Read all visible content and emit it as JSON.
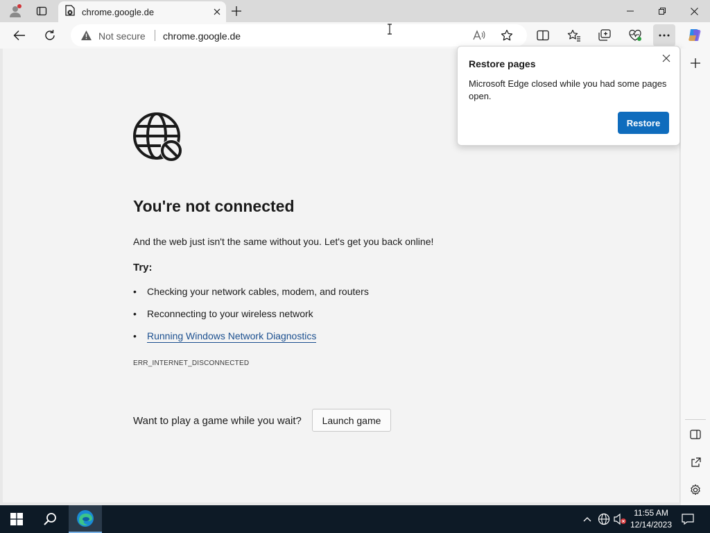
{
  "browser": {
    "tab": {
      "title": "chrome.google.de"
    },
    "address_bar": {
      "security_label": "Not secure",
      "url": "chrome.google.de"
    }
  },
  "error_page": {
    "headline": "You're not connected",
    "subtext": "And the web just isn't the same without you. Let's get you back online!",
    "try_label": "Try:",
    "suggestions": [
      {
        "text": "Checking your network cables, modem, and routers",
        "is_link": false
      },
      {
        "text": "Reconnecting to your wireless network",
        "is_link": false
      },
      {
        "text": "Running Windows Network Diagnostics",
        "is_link": true
      }
    ],
    "error_code": "ERR_INTERNET_DISCONNECTED",
    "game_prompt": "Want to play a game while you wait?",
    "game_button": "Launch game"
  },
  "popup": {
    "title": "Restore pages",
    "message": "Microsoft Edge closed while you had some pages open.",
    "button": "Restore"
  },
  "taskbar": {
    "time": "11:55 AM",
    "date": "12/14/2023"
  },
  "colors": {
    "accent": "#0f6cbd",
    "link": "#1b4f8f",
    "taskbar": "#0d1a26"
  }
}
